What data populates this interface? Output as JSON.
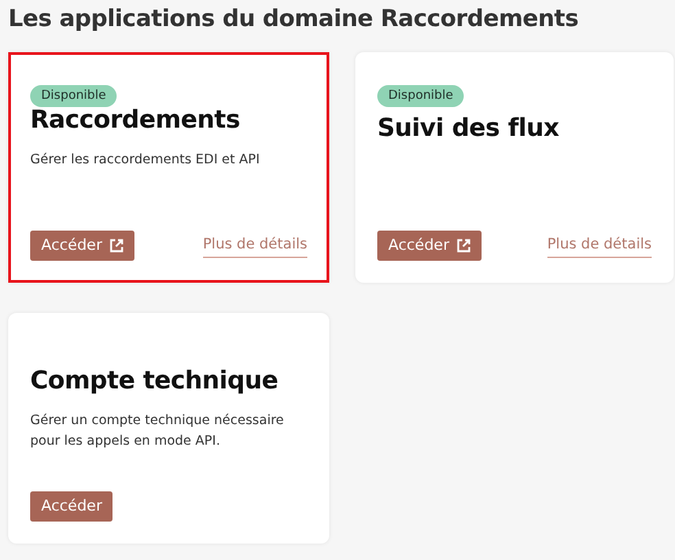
{
  "page_title": "Les applications du domaine Raccordements",
  "apps": [
    {
      "badge": "Disponible",
      "name": "Raccordements",
      "description": "Gérer les raccordements EDI et API",
      "button": {
        "label": "Accéder",
        "external": true
      },
      "details_link": "Plus de détails",
      "selected": true
    },
    {
      "badge": "Disponible",
      "name": "Suivi des flux",
      "button": {
        "label": "Accéder",
        "external": true
      },
      "details_link": "Plus de détails",
      "selected": false
    },
    {
      "name": "Compte technique",
      "description": "Gérer un compte technique nécessaire pour les appels en mode API.",
      "button": {
        "label": "Accéder",
        "external": false
      },
      "selected": false
    }
  ]
}
